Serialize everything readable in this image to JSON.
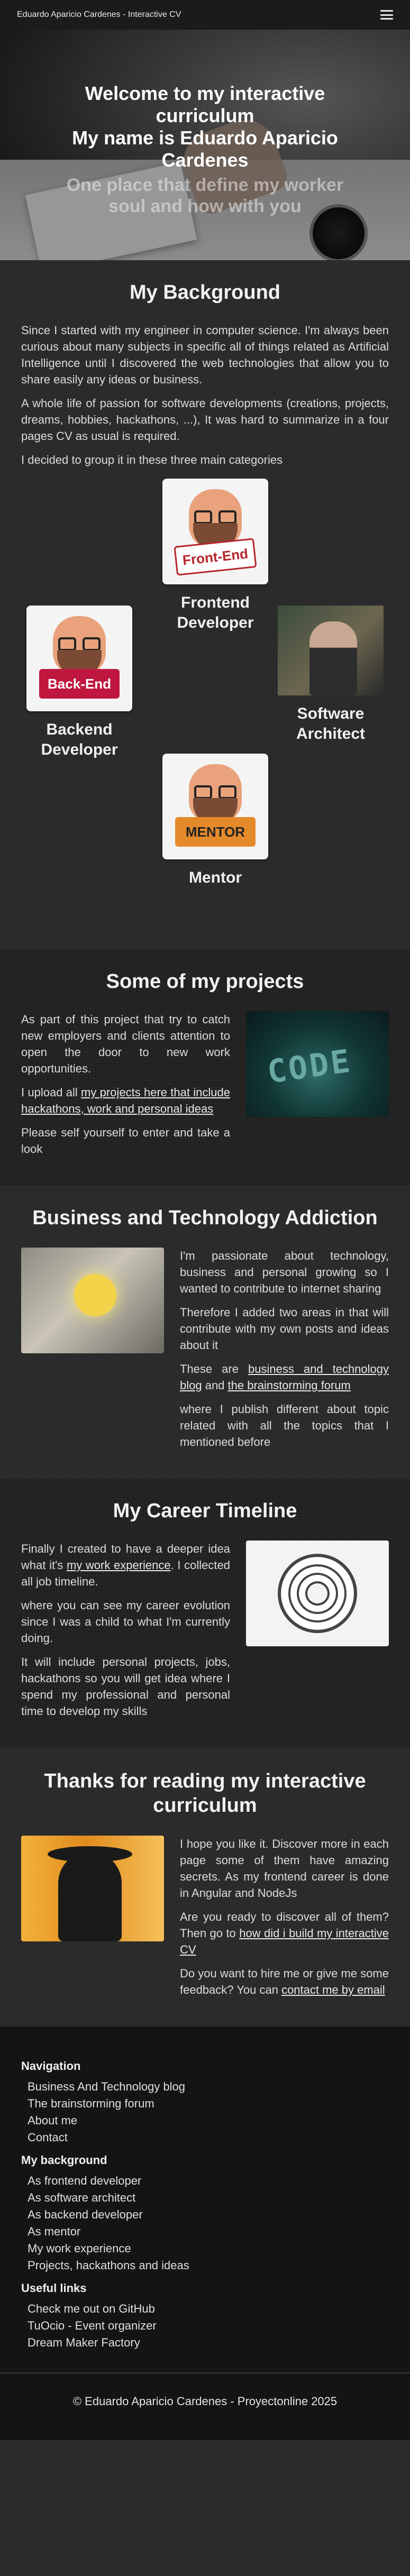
{
  "navbar": {
    "brand": "Eduardo Aparicio Cardenes - Interactive CV",
    "menu_icon": "hamburger-menu-icon"
  },
  "hero": {
    "title_line1": "Welcome to my interactive curriculum",
    "title_line2": "My name is Eduardo Aparicio Cardenes",
    "tagline": "One place that define my worker soul and how with you"
  },
  "background": {
    "title": "My Background",
    "p1": "Since I started with my engineer in computer science. I'm always been curious about many subjects in specific all of things related as Artificial Intelligence until I discovered the web technologies that allow you to share easily any ideas or business.",
    "p2": "A whole life of passion for software developments (creations, projects, dreams, hobbies, hackathons, ...), It was hard to summarize in a four pages CV as usual is required.",
    "p3": "I decided to group it in these three main categories",
    "categories": {
      "frontend": {
        "label_line1": "Frontend",
        "label_line2": "Developer",
        "sign": "Front-End"
      },
      "backend": {
        "label_line1": "Backend",
        "label_line2": "Developer",
        "sign": "Back-End"
      },
      "architect": {
        "label_line1": "Software",
        "label_line2": "Architect"
      },
      "mentor": {
        "label_line1": "Mentor",
        "sign": "MENTOR"
      }
    }
  },
  "projects": {
    "title": "Some of my projects",
    "p1": "As part of this project that try to catch new employers and clients attention to open the door to new work opportunities.",
    "p2_before": "I upload all ",
    "p2_link": "my projects here that include hackathons, work and personal ideas",
    "p3": "Please self yourself to enter and take a look",
    "image_text": "CODE"
  },
  "addiction": {
    "title": "Business and Technology Addiction",
    "p1": "I'm passionate about technology, business and personal growing so I wanted to contribute to internet sharing",
    "p2": "Therefore I added two areas in that will contribute with my own posts and ideas about it",
    "p3_before": "These are ",
    "p3_link1": "business and technology blog",
    "p3_mid": " and ",
    "p3_link2": "the brainstorming forum",
    "p4": "where I publish different about topic related with all the topics that I mentioned before"
  },
  "timeline": {
    "title": "My Career Timeline",
    "p1_before": "Finally I created to have a deeper idea what it's ",
    "p1_link": "my work experience",
    "p1_after": ". I collected all job timeline.",
    "p2": "where you can see my career evolution since I was a child to what I'm currently doing.",
    "p3": "It will include personal projects, jobs, hackathons so you will get idea where I spend my professional and personal time to develop my skills"
  },
  "thanks": {
    "title": "Thanks for reading my interactive curriculum",
    "p1": "I hope you like it. Discover more in each page some of them have amazing secrets. As my frontend career is done in Angular and NodeJs",
    "p2_before": "Are you ready to discover all of them? Then go to ",
    "p2_link": "how did i build my interactive CV",
    "p3_before": "Do you want to hire me or give me some feedback? You can ",
    "p3_link": "contact me by email"
  },
  "footer": {
    "navigation": {
      "heading": "Navigation",
      "items": [
        "Business And Technology blog",
        "The brainstorming forum",
        "About me",
        "Contact"
      ]
    },
    "background": {
      "heading": "My background",
      "items": [
        "As frontend developer",
        "As software architect",
        "As backend developer",
        "As mentor",
        "My work experience",
        "Projects, hackathons and ideas"
      ]
    },
    "useful": {
      "heading": "Useful links",
      "items": [
        "Check me out on GitHub",
        "TuOcio - Event organizer",
        "Dream Maker Factory"
      ]
    },
    "copyright": "© Eduardo Aparicio Cardenes - Proyectonline 2025"
  }
}
